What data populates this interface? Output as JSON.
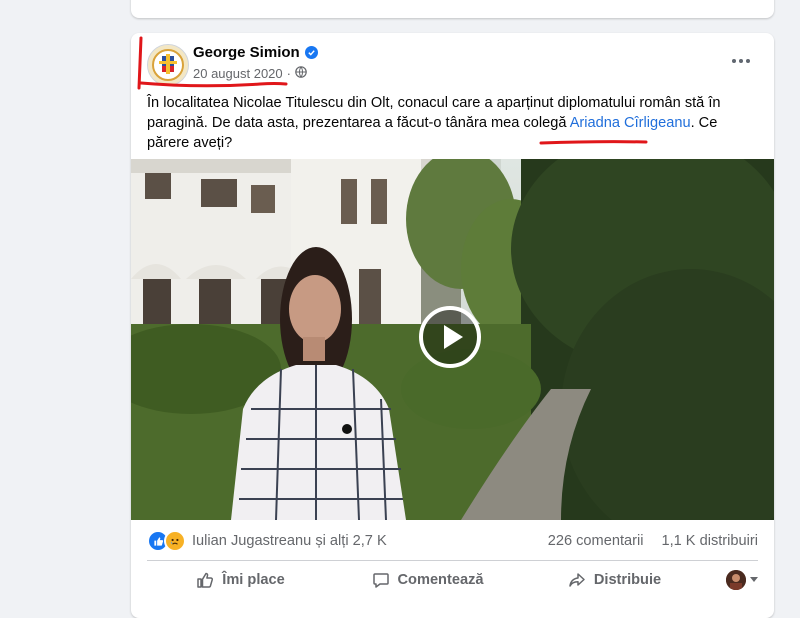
{
  "post": {
    "author": "George Simion",
    "date": "20 august 2020",
    "separator": "·",
    "text_before_link": "În localitatea Nicolae Titulescu din Olt, conacul care a aparținut diplomatului român stă în paragină. De data asta, prezentarea a făcut-o tânăra mea colegă ",
    "link_text": "Ariadna Cîrligeanu",
    "text_after_link": ". Ce părere aveți?"
  },
  "reactions": {
    "summary": "Iulian Jugastreanu și alți 2,7 K",
    "comments": "226 comentarii",
    "shares": "1,1 K distribuiri",
    "icons": [
      "like-icon",
      "sad-icon"
    ]
  },
  "actions": {
    "like": "Îmi place",
    "comment": "Comentează",
    "share": "Distribuie"
  },
  "colors": {
    "link": "#216fdb",
    "verified": "#1877f2",
    "annotation": "#e0161a",
    "background": "#f0f2f5"
  }
}
